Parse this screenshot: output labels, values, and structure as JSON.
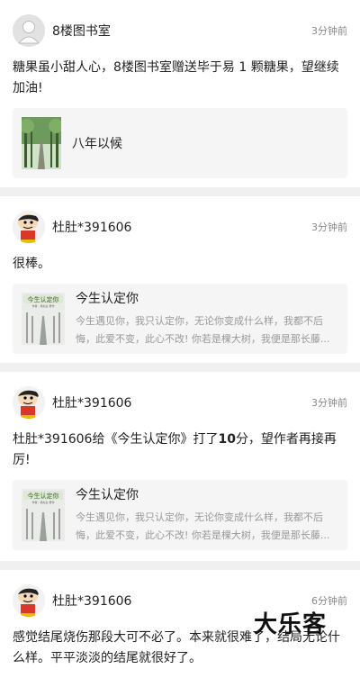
{
  "comments": [
    {
      "username": "8楼图书室",
      "time": "3分钟前",
      "text": "糖果虽小甜人心，8楼图书室赠送毕于易 1 颗糖果，望继续加油!",
      "book": {
        "title": "八年以候",
        "desc": ""
      }
    },
    {
      "username": "杜肚*391606",
      "time": "3分钟前",
      "text": "很棒。",
      "book": {
        "title": "今生认定你",
        "desc": "今生遇见你，我只认定你，无论你变成什么样，我都不后悔，此爱不变，此心不改! 你若是棵大树，我便是那长藤..."
      }
    },
    {
      "username": "杜肚*391606",
      "time": "3分钟前",
      "text_before": "杜肚*391606给《今生认定你》打了",
      "text_score": "10",
      "text_after": "分，望作者再接再厉!",
      "book": {
        "title": "今生认定你",
        "desc": "今生遇见你，我只认定你，无论你变成什么样，我都不后悔，此爱不变，此心不改! 你若是棵大树，我便是那长藤..."
      }
    },
    {
      "username": "杜肚*391606",
      "time": "6分钟前",
      "text": "感觉结尾烧伤那段大可不必了。本来就很难了，结局无论什么样。平平淡淡的结尾就很好了。"
    }
  ],
  "cover_text": {
    "title": "今生认定你",
    "sub": "作者：杨先生 著作"
  },
  "watermark": "大乐客"
}
